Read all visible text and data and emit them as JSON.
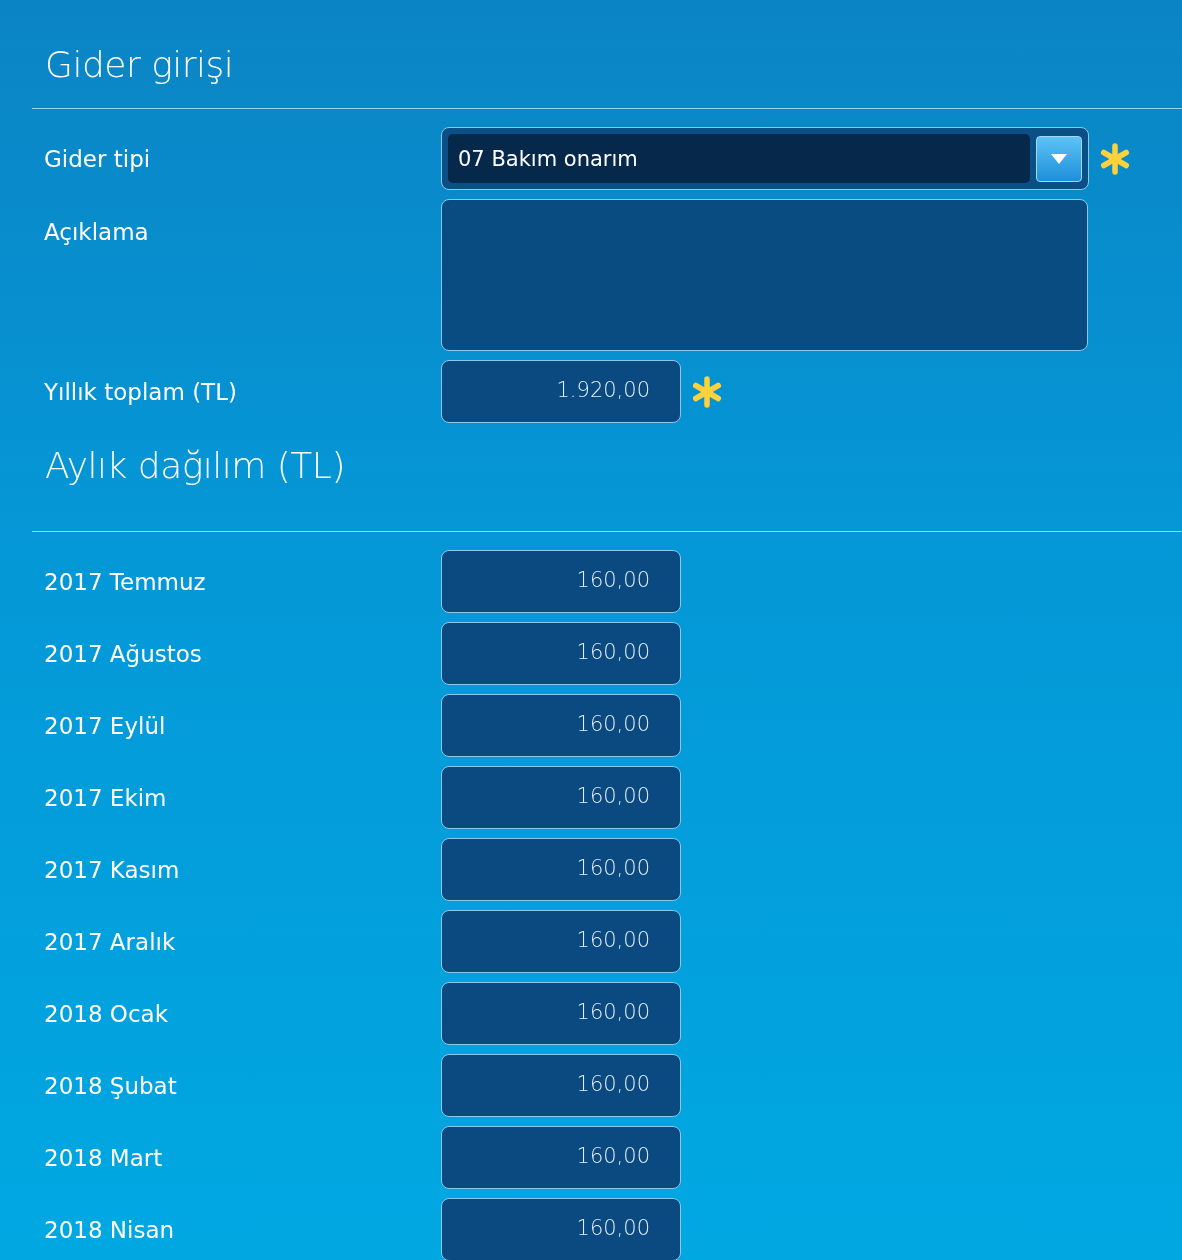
{
  "sections": [
    {
      "title": "Gider girişi",
      "fields": [
        {
          "kind": "dropdown",
          "label": "Gider tipi",
          "value": "07 Bakım onarım",
          "required": true
        },
        {
          "kind": "textarea",
          "label": "Açıklama",
          "required": false
        },
        {
          "kind": "number",
          "label": "Yıllık toplam (TL)",
          "value": "1.920,00",
          "required": true
        }
      ]
    },
    {
      "title": "Aylık dağılım (TL)",
      "fields": [
        {
          "kind": "number",
          "label": "2017 Temmuz",
          "value": "160,00",
          "required": false
        },
        {
          "kind": "number",
          "label": "2017 Ağustos",
          "value": "160,00",
          "required": false
        },
        {
          "kind": "number",
          "label": "2017 Eylül",
          "value": "160,00",
          "required": false
        },
        {
          "kind": "number",
          "label": "2017 Ekim",
          "value": "160,00",
          "required": false
        },
        {
          "kind": "number",
          "label": "2017 Kasım",
          "value": "160,00",
          "required": false
        },
        {
          "kind": "number",
          "label": "2017 Aralık",
          "value": "160,00",
          "required": false
        },
        {
          "kind": "number",
          "label": "2018 Ocak",
          "value": "160,00",
          "required": false
        },
        {
          "kind": "number",
          "label": "2018 Şubat",
          "value": "160,00",
          "required": false
        },
        {
          "kind": "number",
          "label": "2018 Mart",
          "value": "160,00",
          "required": false
        },
        {
          "kind": "number",
          "label": "2018 Nisan",
          "value": "160,00",
          "required": false
        }
      ]
    }
  ]
}
